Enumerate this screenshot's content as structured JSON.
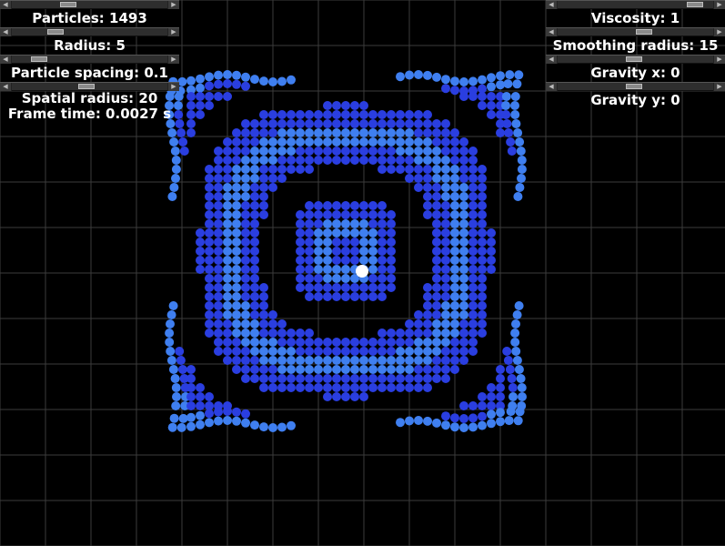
{
  "left_panel": {
    "particles": {
      "label": "Particles: 1493",
      "value_fraction": 0.35
    },
    "radius": {
      "label": "Radius: 5",
      "value_fraction": 0.26
    },
    "particle_spacing": {
      "label": "Particle spacing: 0.1",
      "value_fraction": 0.14
    },
    "spatial_radius": {
      "label": "Spatial radius: 20",
      "value_fraction": 0.48
    },
    "frame_time": "Frame time: 0.0027 s"
  },
  "right_panel": {
    "viscosity": {
      "label": "Viscosity: 1",
      "value_fraction": 0.92
    },
    "smoothing_radius": {
      "label": "Smoothing radius: 15",
      "value_fraction": 0.56
    },
    "gravity_x": {
      "label": "Gravity x: 0",
      "value_fraction": 0.49
    },
    "gravity_y": {
      "label": "Gravity y: 0",
      "value_fraction": 0.49
    }
  },
  "colors": {
    "background": "#000000",
    "grid": "#3c3c3c",
    "particle": "#2a3ee0",
    "particle_highlight": "#3f7ff0",
    "cursor": "#ffffff"
  },
  "icons": {
    "slider_left": "left-arrow-icon",
    "slider_right": "right-arrow-icon",
    "cursor": "pointer-dot-icon"
  }
}
